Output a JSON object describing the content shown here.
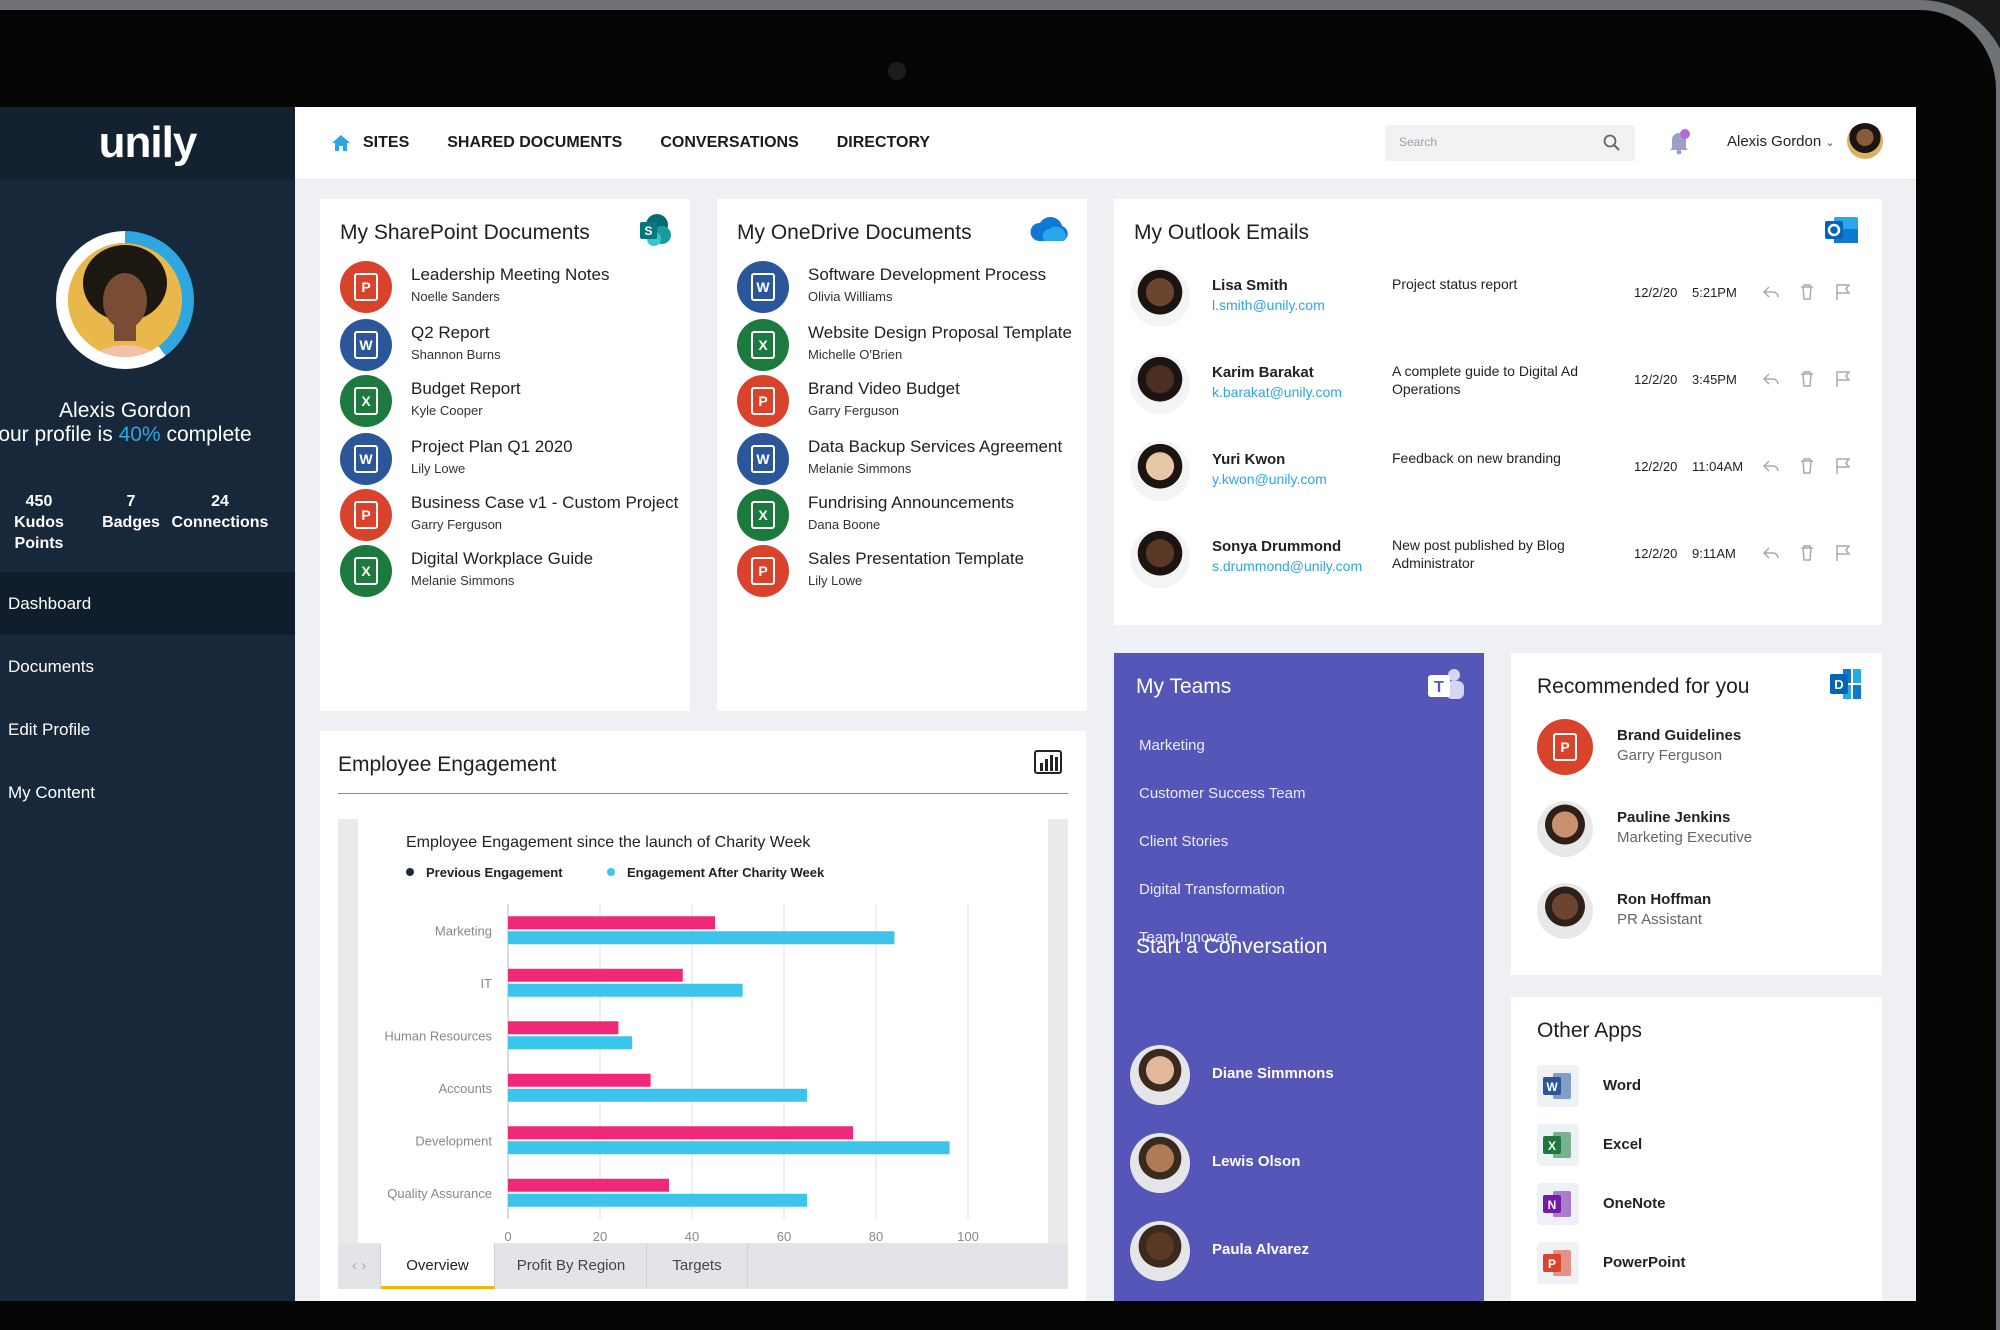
{
  "app": {
    "logo": "unily"
  },
  "topnav": {
    "sites": "SITES",
    "shared": "SHARED DOCUMENTS",
    "conversations": "CONVERSATIONS",
    "directory": "DIRECTORY"
  },
  "search": {
    "placeholder": "Search"
  },
  "user": {
    "name": "Alexis Gordon"
  },
  "sidebar": {
    "name": "Alexis Gordon",
    "complete_prefix": "our profile is",
    "complete_pct": "40%",
    "complete_suffix": "complete",
    "stats": [
      {
        "value": "450",
        "label": "Kudos Points"
      },
      {
        "value": "7",
        "label": "Badges"
      },
      {
        "value": "24",
        "label": "Connections"
      }
    ],
    "items": [
      {
        "label": "Dashboard"
      },
      {
        "label": "Documents"
      },
      {
        "label": "Edit Profile"
      },
      {
        "label": "My Content"
      }
    ]
  },
  "sharepoint": {
    "title": "My SharePoint Documents",
    "docs": [
      {
        "title": "Leadership Meeting Notes",
        "author": "Noelle Sanders",
        "type": "ppt"
      },
      {
        "title": "Q2 Report",
        "author": "Shannon Burns",
        "type": "word"
      },
      {
        "title": "Budget Report",
        "author": "Kyle Cooper",
        "type": "excel"
      },
      {
        "title": "Project Plan Q1 2020",
        "author": "Lily Lowe",
        "type": "word"
      },
      {
        "title": "Business Case v1 - Custom Project",
        "author": "Garry Ferguson",
        "type": "ppt"
      },
      {
        "title": "Digital Workplace Guide",
        "author": "Melanie Simmons",
        "type": "excel"
      }
    ]
  },
  "onedrive": {
    "title": "My OneDrive Documents",
    "docs": [
      {
        "title": "Software Development Process",
        "author": "Olivia Williams",
        "type": "word"
      },
      {
        "title": "Website Design Proposal Template",
        "author": "Michelle O'Brien",
        "type": "excel"
      },
      {
        "title": "Brand Video Budget",
        "author": "Garry Ferguson",
        "type": "ppt"
      },
      {
        "title": "Data Backup Services Agreement",
        "author": "Melanie Simmons",
        "type": "word"
      },
      {
        "title": "Fundrising Announcements",
        "author": "Dana Boone",
        "type": "excel"
      },
      {
        "title": "Sales Presentation Template",
        "author": "Lily Lowe",
        "type": "ppt"
      }
    ]
  },
  "outlook": {
    "title": "My Outlook Emails",
    "emails": [
      {
        "name": "Lisa Smith",
        "email": "l.smith@unily.com",
        "subject": "Project status report",
        "date": "12/2/20",
        "time": "5:21PM"
      },
      {
        "name": "Karim Barakat",
        "email": "k.barakat@unily.com",
        "subject": "A complete guide to Digital Ad Operations",
        "date": "12/2/20",
        "time": "3:45PM"
      },
      {
        "name": "Yuri Kwon",
        "email": "y.kwon@unily.com",
        "subject": "Feedback on new branding",
        "date": "12/2/20",
        "time": "11:04AM"
      },
      {
        "name": "Sonya Drummond",
        "email": "s.drummond@unily.com",
        "subject": "New post published by Blog Administrator",
        "date": "12/2/20",
        "time": "9:11AM"
      }
    ]
  },
  "teams": {
    "title": "My Teams",
    "items": [
      "Marketing",
      "Customer Success Team",
      "Client Stories",
      "Digital Transformation",
      "Team Innovate"
    ],
    "conv_title": "Start a Conversation",
    "people": [
      "Diane Simmnons",
      "Lewis Olson",
      "Paula Alvarez"
    ]
  },
  "recommended": {
    "title": "Recommended for you",
    "items": [
      {
        "name": "Brand Guidelines",
        "role": "Garry Ferguson"
      },
      {
        "name": "Pauline Jenkins",
        "role": "Marketing Executive"
      },
      {
        "name": "Ron Hoffman",
        "role": "PR Assistant"
      }
    ]
  },
  "other_apps": {
    "title": "Other Apps",
    "items": [
      {
        "name": "Word",
        "color": "#2b579a"
      },
      {
        "name": "Excel",
        "color": "#1d7a3e"
      },
      {
        "name": "OneNote",
        "color": "#7719aa"
      },
      {
        "name": "PowerPoint",
        "color": "#d9432c"
      }
    ]
  },
  "engagement": {
    "title": "Employee Engagement",
    "tabs": [
      "Overview",
      "Profit By Region",
      "Targets"
    ]
  },
  "colors": {
    "previous": "#f0287a",
    "after": "#3cc4ea",
    "accent": "#2ea6e0",
    "teams": "#5656b8"
  },
  "chart_data": {
    "type": "bar",
    "orientation": "horizontal",
    "title": "Employee Engagement since the launch of Charity Week",
    "categories": [
      "Marketing",
      "IT",
      "Human Resources",
      "Accounts",
      "Development",
      "Quality Assurance"
    ],
    "series": [
      {
        "name": "Previous Engagement",
        "values": [
          45,
          38,
          24,
          31,
          75,
          35
        ]
      },
      {
        "name": "Engagement After Charity Week",
        "values": [
          84,
          51,
          27,
          65,
          96,
          65
        ]
      }
    ],
    "xticks": [
      "0",
      "20",
      "40",
      "60",
      "80",
      "100"
    ],
    "xlim": [
      0,
      100
    ],
    "legend": "top-left",
    "grid": true
  }
}
